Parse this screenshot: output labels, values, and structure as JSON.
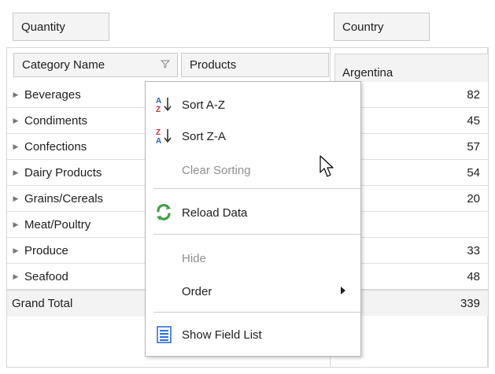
{
  "fields": {
    "quantity": "Quantity",
    "country": "Country",
    "category_name": "Category Name",
    "products": "Products"
  },
  "pivot": {
    "country_value": "Argentina",
    "rows": [
      {
        "label": "Beverages",
        "value": "82"
      },
      {
        "label": "Condiments",
        "value": "45"
      },
      {
        "label": "Confections",
        "value": "57"
      },
      {
        "label": "Dairy Products",
        "value": "54"
      },
      {
        "label": "Grains/Cereals",
        "value": "20"
      },
      {
        "label": "Meat/Poultry",
        "value": ""
      },
      {
        "label": "Produce",
        "value": "33"
      },
      {
        "label": "Seafood",
        "value": "48"
      }
    ],
    "grand_total_label": "Grand Total",
    "grand_total_value": "339"
  },
  "context_menu": {
    "sort_az": "Sort A-Z",
    "sort_za": "Sort Z-A",
    "clear_sorting": "Clear Sorting",
    "reload_data": "Reload Data",
    "hide": "Hide",
    "order": "Order",
    "show_field_list": "Show Field List"
  },
  "icons": {
    "filter": "filter-icon",
    "expand": "expand-arrow-icon",
    "sort_az": "sort-az-icon",
    "sort_za": "sort-za-icon",
    "reload": "reload-icon",
    "field_list": "field-list-icon",
    "submenu": "submenu-arrow-icon",
    "cursor": "mouse-pointer-icon"
  },
  "colors": {
    "header_bg": "#f4f4f4",
    "border": "#c9c9c9",
    "menu_border": "#b8b8b8",
    "disabled_text": "#909090",
    "reload_green": "#43a047",
    "field_list_blue": "#2f6fdb",
    "sort_red": "#cc2f2f",
    "sort_blue": "#2562c7"
  }
}
